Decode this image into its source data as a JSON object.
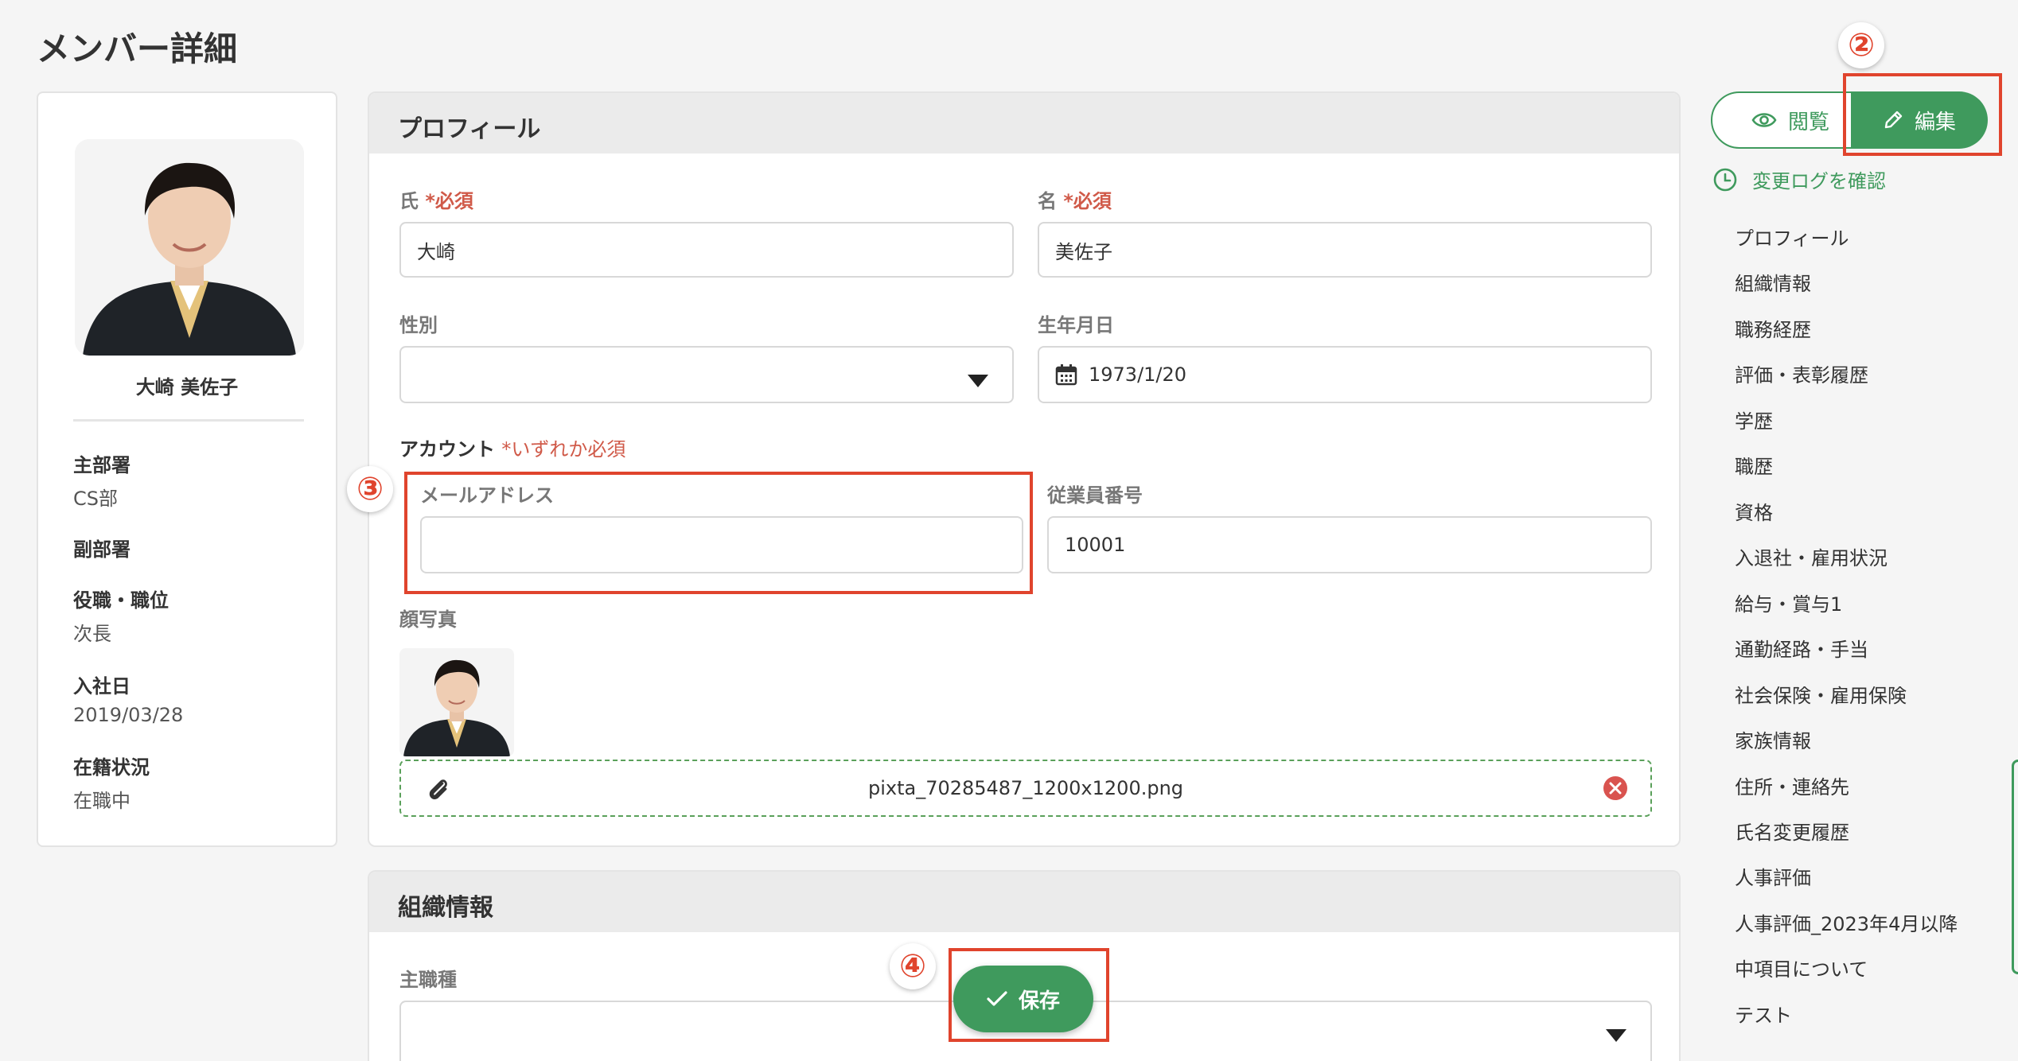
{
  "page": {
    "title": "メンバー詳細"
  },
  "member_card": {
    "name": "大崎 美佐子",
    "fields": [
      {
        "label": "主部署",
        "value": "CS部"
      },
      {
        "label": "副部署",
        "value": ""
      },
      {
        "label": "役職・職位",
        "value": "次長"
      },
      {
        "label": "入社日",
        "value": "2019/03/28"
      },
      {
        "label": "在籍状況",
        "value": "在職中"
      }
    ]
  },
  "profile": {
    "section_title": "プロフィール",
    "last_name": {
      "label": "氏",
      "required": "*必須",
      "value": "大崎"
    },
    "first_name": {
      "label": "名",
      "required": "*必須",
      "value": "美佐子"
    },
    "gender": {
      "label": "性別",
      "value": ""
    },
    "birthday": {
      "label": "生年月日",
      "value": "1973/1/20"
    },
    "account": {
      "label": "アカウント",
      "note": "*いずれか必須"
    },
    "email": {
      "label": "メールアドレス",
      "value": ""
    },
    "employee_no": {
      "label": "従業員番号",
      "value": "10001"
    },
    "photo": {
      "label": "顔写真",
      "filename": "pixta_70285487_1200x1200.png"
    }
  },
  "org": {
    "section_title": "組織情報",
    "main_job": {
      "label": "主職種",
      "value": ""
    }
  },
  "actions": {
    "view_label": "閲覧",
    "edit_label": "編集",
    "change_log_label": "変更ログを確認",
    "save_label": "保存"
  },
  "annotations": {
    "badge2": "②",
    "badge3": "③",
    "badge4": "④"
  },
  "nav": {
    "items": [
      "プロフィール",
      "組織情報",
      "職務経歴",
      "評価・表彰履歴",
      "学歴",
      "職歴",
      "資格",
      "入退社・雇用状況",
      "給与・賞与1",
      "通勤経路・手当",
      "社会保険・雇用保険",
      "家族情報",
      "住所・連絡先",
      "氏名変更履歴",
      "人事評価",
      "人事評価_2023年4月以降",
      "中項目について",
      "テスト"
    ]
  },
  "colors": {
    "accent": "#3f9a5d",
    "required": "#d05a49",
    "annotation": "#e0442d"
  }
}
